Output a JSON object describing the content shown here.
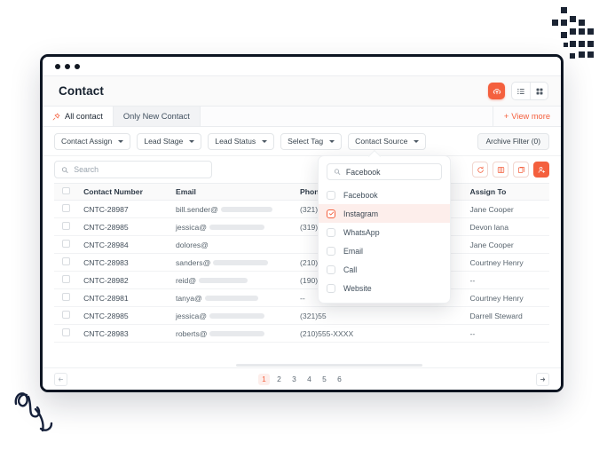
{
  "window": {
    "dots": 3
  },
  "header": {
    "title": "Contact",
    "upload_icon": "upload-cloud-icon",
    "list_view_icon": "list-view-icon",
    "grid_view_icon": "grid-view-icon",
    "accent_color": "#f4603e"
  },
  "tabs": [
    {
      "label": "All contact",
      "active": true,
      "icon": "pin-icon"
    },
    {
      "label": "Only New Contact",
      "active": false
    }
  ],
  "view_more": {
    "label": "View more",
    "prefix": "+"
  },
  "filters": [
    {
      "label": "Contact Assign"
    },
    {
      "label": "Lead Stage"
    },
    {
      "label": "Lead Status"
    },
    {
      "label": "Select Tag"
    },
    {
      "label": "Contact Source"
    }
  ],
  "archive_filter": {
    "label": "Archive Filter (0)"
  },
  "search": {
    "placeholder": "Search",
    "value": "",
    "icon": "search-icon"
  },
  "tools": [
    {
      "name": "refresh-icon",
      "solid": false
    },
    {
      "name": "columns-icon",
      "solid": false
    },
    {
      "name": "copy-icon",
      "solid": false
    },
    {
      "name": "add-user-icon",
      "solid": true
    }
  ],
  "table": {
    "columns": [
      "Contact Number",
      "Email",
      "Phone",
      "",
      "Assign To"
    ],
    "rows": [
      {
        "contact_number": "CNTC-28987",
        "email": "bill.sender@",
        "redact": 58,
        "phone": "(321)55",
        "assign_to": "Jane Cooper"
      },
      {
        "contact_number": "CNTC-28985",
        "email": "jessica@",
        "redact": 62,
        "phone": "(319)55",
        "assign_to": "Devon lana"
      },
      {
        "contact_number": "CNTC-28984",
        "email": "dolores@",
        "redact": 0,
        "phone": "",
        "assign_to": "Jane Cooper"
      },
      {
        "contact_number": "CNTC-28983",
        "email": "sanders@",
        "redact": 62,
        "phone": "(210)55",
        "assign_to": "Courtney Henry"
      },
      {
        "contact_number": "CNTC-28982",
        "email": "reid@",
        "redact": 55,
        "phone": "(190)55",
        "assign_to": "--"
      },
      {
        "contact_number": "CNTC-28981",
        "email": "tanya@",
        "redact": 60,
        "phone": "--",
        "assign_to": "Courtney Henry"
      },
      {
        "contact_number": "CNTC-28985",
        "email": "jessica@",
        "redact": 62,
        "phone": "(321)55",
        "assign_to": "Darrell Steward"
      },
      {
        "contact_number": "CNTC-28983",
        "email": "roberts@",
        "redact": 62,
        "phone": "(210)555-XXXX",
        "assign_to": "--"
      }
    ]
  },
  "dropdown": {
    "search": {
      "value": "Facebook",
      "icon": "search-icon"
    },
    "options": [
      {
        "label": "Facebook",
        "checked": false
      },
      {
        "label": "Instagram",
        "checked": true
      },
      {
        "label": "WhatsApp",
        "checked": false
      },
      {
        "label": "Email",
        "checked": false
      },
      {
        "label": "Call",
        "checked": false
      },
      {
        "label": "Website",
        "checked": false
      }
    ],
    "highlight_color": "#fdeeeb"
  },
  "pagination": {
    "prev_icon": "arrow-left-icon",
    "next_icon": "arrow-right-icon",
    "pages": [
      "1",
      "2",
      "3",
      "4",
      "5",
      "6"
    ],
    "active_page": "1"
  }
}
